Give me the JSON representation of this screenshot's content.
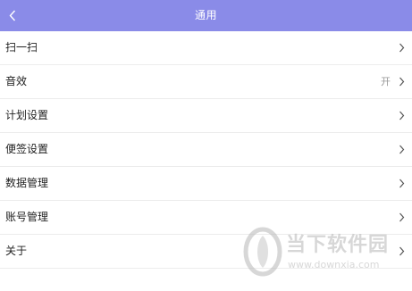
{
  "header": {
    "title": "通用",
    "back_icon": "chevron-left-icon",
    "background": "#8a8be8"
  },
  "rows": [
    {
      "label": "扫一扫",
      "value": ""
    },
    {
      "label": "音效",
      "value": "开"
    },
    {
      "label": "计划设置",
      "value": ""
    },
    {
      "label": "便签设置",
      "value": ""
    },
    {
      "label": "数据管理",
      "value": ""
    },
    {
      "label": "账号管理",
      "value": ""
    },
    {
      "label": "关于",
      "value": ""
    }
  ],
  "watermark": {
    "text": "当下软件园",
    "url": "www.downxia.com"
  }
}
